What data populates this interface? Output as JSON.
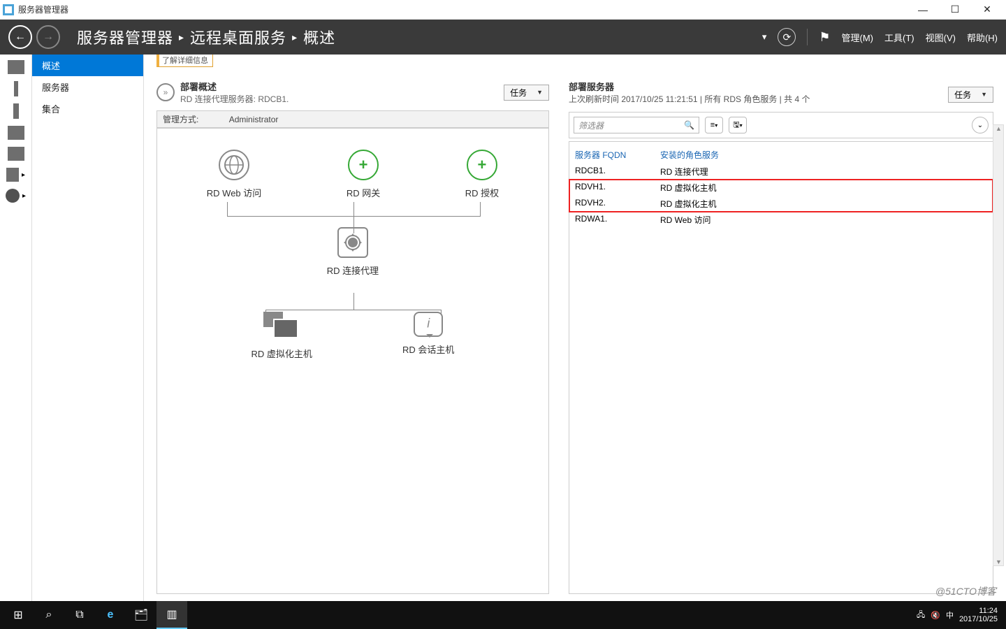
{
  "window": {
    "title": "服务器管理器"
  },
  "win_controls": {
    "min": "—",
    "max": "☐",
    "close": "✕"
  },
  "breadcrumb": {
    "app": "服务器管理器",
    "section": "远程桌面服务",
    "page": "概述",
    "sep": "▸"
  },
  "header_menu": {
    "manage": "管理(M)",
    "tools": "工具(T)",
    "view": "视图(V)",
    "help": "帮助(H)"
  },
  "sidebar": {
    "items": [
      "概述",
      "服务器",
      "集合"
    ],
    "active": 0
  },
  "info_strip": "了解详细信息",
  "deploy_overview": {
    "title": "部署概述",
    "subtitle": "RD 连接代理服务器: RDCB1.",
    "tasks": "任务",
    "mgmt_label": "管理方式:",
    "mgmt_value": "Administrator",
    "nodes": {
      "web": "RD Web 访问",
      "gateway": "RD 网关",
      "license": "RD 授权",
      "broker": "RD 连接代理",
      "virthost": "RD 虚拟化主机",
      "sessionhost": "RD 会话主机"
    }
  },
  "deploy_servers": {
    "title": "部署服务器",
    "last_refresh": "上次刷新时间 2017/10/25 11:21:51 | 所有 RDS 角色服务  | 共 4 个",
    "tasks": "任务",
    "filter_placeholder": "筛选器",
    "columns": {
      "fqdn": "服务器 FQDN",
      "roles": "安装的角色服务"
    },
    "rows": [
      {
        "fqdn": "RDCB1.",
        "role": "RD 连接代理",
        "hl": false
      },
      {
        "fqdn": "RDVH1.",
        "role": "RD 虚拟化主机",
        "hl": true
      },
      {
        "fqdn": "RDVH2.",
        "role": "RD 虚拟化主机",
        "hl": true
      },
      {
        "fqdn": "RDWA1.",
        "role": "RD Web 访问",
        "hl": false
      }
    ]
  },
  "taskbar": {
    "time": "11:24",
    "date": "2017/10/25",
    "ime": "中",
    "watermark": "@51CTO博客"
  }
}
